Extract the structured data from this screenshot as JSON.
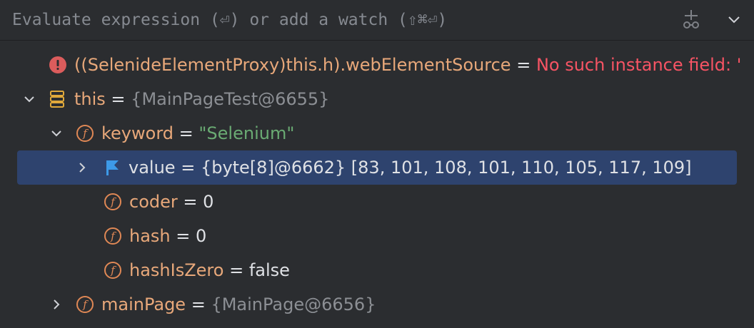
{
  "evaluate_bar": {
    "placeholder": "Evaluate expression (⏎) or add a watch (⇧⌘⏎)",
    "add_watch_icon": "add-watch-icon",
    "more_icon": "chevron-down-icon"
  },
  "tree": {
    "error_row": {
      "icon": "error-icon",
      "name": "((SelenideElementProxy)this.h).webElementSource",
      "eq": " = ",
      "value": "No such instance field: '"
    },
    "this_row": {
      "icon": "object-stack-icon",
      "name": "this",
      "eq": " = ",
      "value": "{MainPageTest@6655}"
    },
    "keyword_row": {
      "icon": "field-icon",
      "name": "keyword",
      "eq": " = ",
      "value": "\"Selenium\""
    },
    "value_row": {
      "icon": "flag-icon",
      "name": "value",
      "eq": " = ",
      "ref": "{byte[8]@6662} ",
      "value": "[83, 101, 108, 101, 110, 105, 117, 109]"
    },
    "coder_row": {
      "icon": "field-icon",
      "name": "coder",
      "eq": " = ",
      "value": "0"
    },
    "hash_row": {
      "icon": "field-icon",
      "name": "hash",
      "eq": " = ",
      "value": "0"
    },
    "hashiszero_row": {
      "icon": "field-icon",
      "name": "hashIsZero",
      "eq": " = ",
      "value": "false"
    },
    "mainpage_row": {
      "icon": "field-icon",
      "name": "mainPage",
      "eq": " = ",
      "value": "{MainPage@6656}"
    },
    "field_icon_glyph": "f"
  },
  "colors": {
    "background": "#2b2d30",
    "selection": "#2e436e",
    "field_name": "#e8a87a",
    "string": "#6aab73",
    "error": "#f75464",
    "reference": "#8c8f94"
  }
}
